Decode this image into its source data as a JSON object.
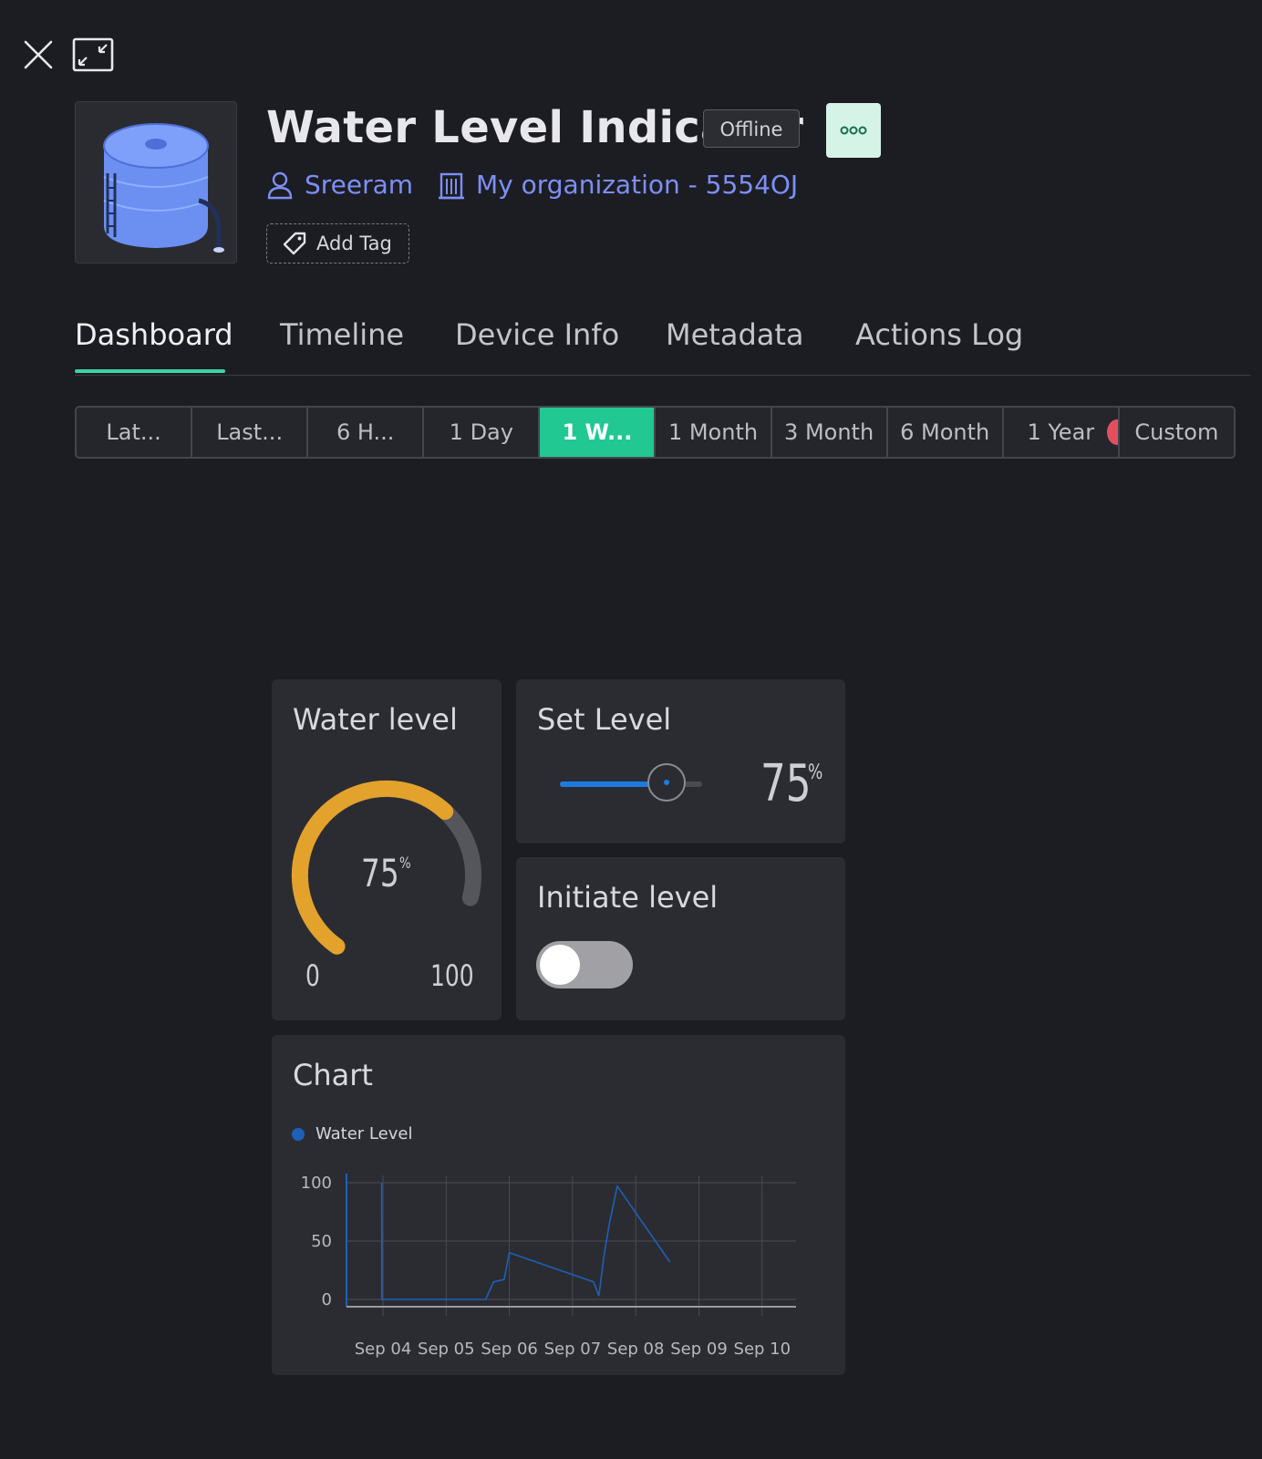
{
  "window": {
    "close_icon": "close-icon",
    "collapse_icon": "collapse-icon"
  },
  "device": {
    "title": "Water Level Indicator",
    "status": "Offline",
    "owner": "Sreeram",
    "organization": "My organization - 5554OJ",
    "add_tag_label": "Add Tag",
    "image_icon": "water-tank-icon",
    "more_icon": "more-dots-icon"
  },
  "tabs": [
    {
      "label": "Dashboard",
      "active": true
    },
    {
      "label": "Timeline"
    },
    {
      "label": "Device Info"
    },
    {
      "label": "Metadata"
    },
    {
      "label": "Actions Log"
    }
  ],
  "time_ranges": [
    {
      "label": "Lat..."
    },
    {
      "label": "Last..."
    },
    {
      "label": "6 H..."
    },
    {
      "label": "1 Day"
    },
    {
      "label": "1 W...",
      "active": true
    },
    {
      "label": "1 Month"
    },
    {
      "label": "3 Month"
    },
    {
      "label": "6 Month"
    },
    {
      "label": "1 Year"
    },
    {
      "label": "Custom"
    }
  ],
  "widgets": {
    "water_level": {
      "title": "Water level",
      "value": "75",
      "unit": "%",
      "min": "0",
      "max": "100",
      "fraction": 0.75
    },
    "set_level": {
      "title": "Set Level",
      "value": "75",
      "unit": "%",
      "fraction": 0.75
    },
    "initiate_level": {
      "title": "Initiate level",
      "on": false
    },
    "chart": {
      "title": "Chart"
    }
  },
  "colors": {
    "accent": "#21c892",
    "gauge": "#e3a22b",
    "series": "#1e5fb8",
    "link": "#7d8ff7"
  },
  "chart_data": {
    "type": "line",
    "title": "Chart",
    "series": [
      {
        "name": "Water Level",
        "points": [
          [
            "Sep 03 23:30",
            100
          ],
          [
            "Sep 03 23:32",
            0
          ],
          [
            "Sep 05 15:00",
            0
          ],
          [
            "Sep 05 18:00",
            15
          ],
          [
            "Sep 05 22:00",
            17
          ],
          [
            "Sep 06 00:00",
            40
          ],
          [
            "Sep 07 08:00",
            15
          ],
          [
            "Sep 07 10:00",
            3
          ],
          [
            "Sep 07 12:00",
            38
          ],
          [
            "Sep 07 14:00",
            65
          ],
          [
            "Sep 07 17:00",
            97
          ],
          [
            "Sep 08 13:00",
            32
          ]
        ]
      }
    ],
    "x_ticks": [
      "Sep 04",
      "Sep 05",
      "Sep 06",
      "Sep 07",
      "Sep 08",
      "Sep 09",
      "Sep 10"
    ],
    "y_ticks": [
      0,
      50,
      100
    ],
    "ylim": [
      0,
      100
    ],
    "grid": true,
    "legend": "top-left"
  }
}
